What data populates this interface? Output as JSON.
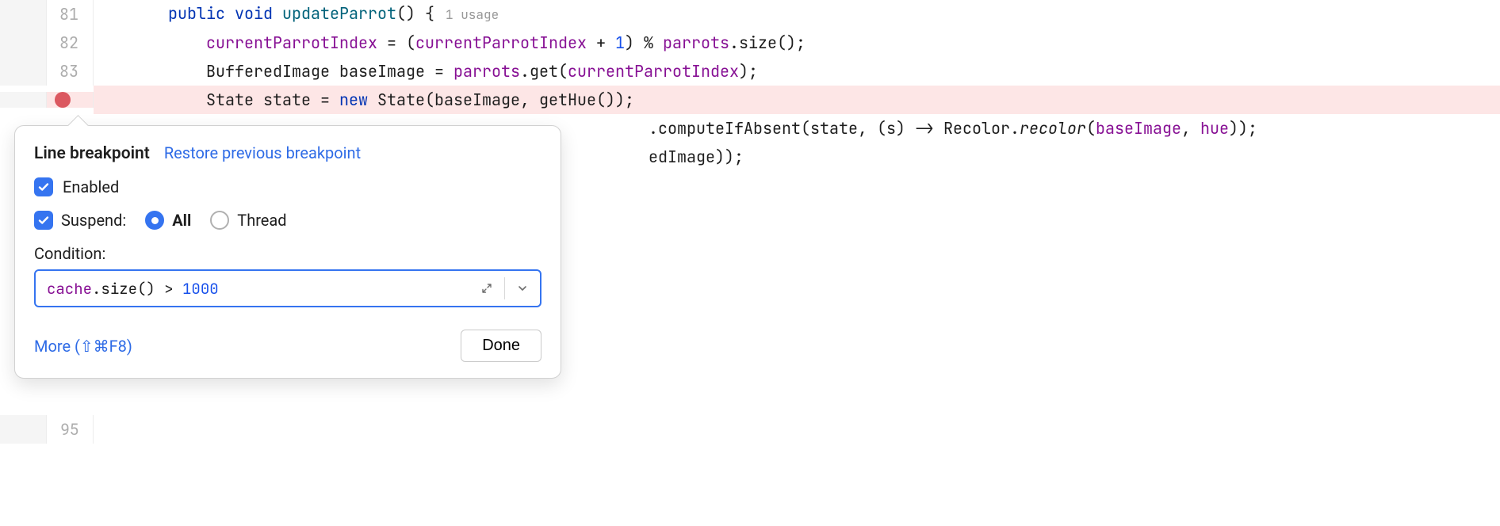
{
  "editor": {
    "lines": [
      {
        "num": "81"
      },
      {
        "num": "82"
      },
      {
        "num": "83"
      },
      {
        "num": ""
      },
      {
        "num": ""
      },
      {
        "num": ""
      },
      {
        "num": "95"
      }
    ],
    "code": {
      "l81_kw1": "public",
      "l81_kw2": "void",
      "l81_method": "updateParrot",
      "l81_paren": "() {",
      "l81_usage": "1 usage",
      "l82_a": "currentParrotIndex",
      "l82_b": " = (",
      "l82_c": "currentParrotIndex",
      "l82_d": " + ",
      "l82_num": "1",
      "l82_e": ") % ",
      "l82_f": "parrots",
      "l82_g": ".size();",
      "l83_a": "BufferedImage ",
      "l83_b": "baseImage",
      "l83_c": " = ",
      "l83_d": "parrots",
      "l83_e": ".get(",
      "l83_f": "currentParrotIndex",
      "l83_g": ");",
      "l84_a": "State ",
      "l84_b": "state",
      "l84_c": " = ",
      "l84_kw": "new",
      "l84_d": " State(",
      "l84_e": "baseImage",
      "l84_f": ", getHue());",
      "l85_a": ".computeIfAbsent(",
      "l85_b": "state",
      "l85_c": ", (",
      "l85_d": "s",
      "l85_e": ") -> Recolor.",
      "l85_f": "recolor",
      "l85_g": "(",
      "l85_h": "baseImage",
      "l85_i": ", ",
      "l85_j": "hue",
      "l85_k": "));",
      "l86_a": "edImage));"
    }
  },
  "popup": {
    "title": "Line breakpoint",
    "restore_link": "Restore previous breakpoint",
    "enabled_label": "Enabled",
    "suspend_label": "Suspend:",
    "radio_all": "All",
    "radio_thread": "Thread",
    "condition_label": "Condition:",
    "condition_id": "cache",
    "condition_mid": ".size() > ",
    "condition_num": "1000",
    "more_link": "More (⇧⌘F8)",
    "done_label": "Done"
  }
}
